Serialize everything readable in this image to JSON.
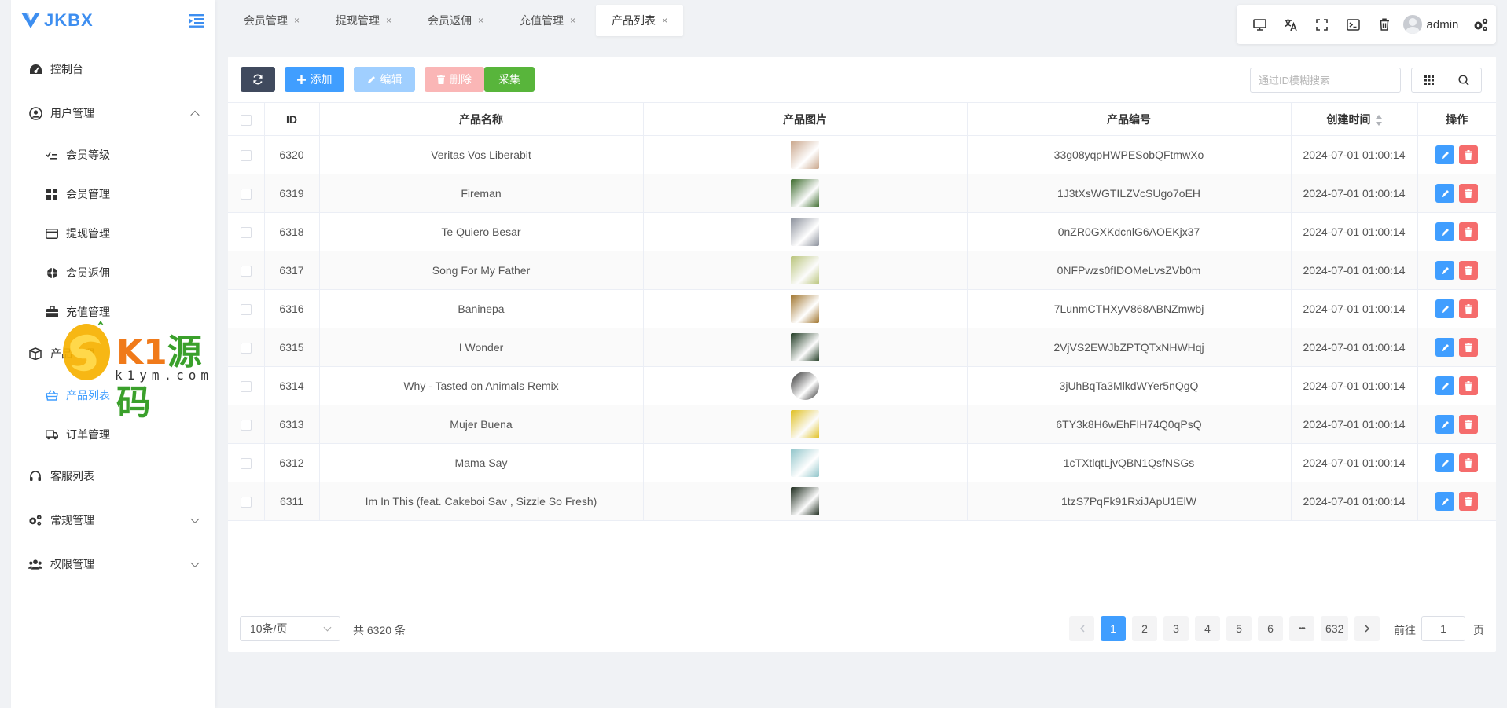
{
  "app": {
    "logo_text": "JKBX"
  },
  "sidebar": {
    "items": [
      {
        "label": "控制台",
        "icon": "dashboard-icon"
      },
      {
        "label": "用户管理",
        "icon": "user-circle-icon",
        "expanded": true
      },
      {
        "label": "会员等级",
        "icon": "level-icon"
      },
      {
        "label": "会员管理",
        "icon": "grid-icon"
      },
      {
        "label": "提现管理",
        "icon": "card-icon"
      },
      {
        "label": "会员返佣",
        "icon": "target-icon"
      },
      {
        "label": "充值管理",
        "icon": "briefcase-icon"
      },
      {
        "label": "产品管理",
        "icon": "box-icon"
      },
      {
        "label": "产品列表",
        "icon": "basket-icon",
        "active": true
      },
      {
        "label": "订单管理",
        "icon": "truck-icon"
      },
      {
        "label": "客服列表",
        "icon": "headset-icon"
      },
      {
        "label": "常规管理",
        "icon": "gears-icon"
      },
      {
        "label": "权限管理",
        "icon": "users-icon"
      }
    ]
  },
  "watermark": {
    "brand_a": "K1",
    "brand_b": "源码",
    "url": "k1ym.com"
  },
  "tabs": [
    {
      "label": "会员管理",
      "close": "×"
    },
    {
      "label": "提现管理",
      "close": "×"
    },
    {
      "label": "会员返佣",
      "close": "×"
    },
    {
      "label": "充值管理",
      "close": "×"
    },
    {
      "label": "产品列表",
      "close": "×",
      "active": true
    }
  ],
  "topbar": {
    "user": "admin"
  },
  "toolbar": {
    "add_label": "添加",
    "edit_label": "编辑",
    "delete_label": "删除",
    "collect_label": "采集",
    "search_placeholder": "通过ID模糊搜索"
  },
  "table": {
    "columns": [
      "ID",
      "产品名称",
      "产品图片",
      "产品编号",
      "创建时间",
      "操作"
    ],
    "rows": [
      {
        "id": "6320",
        "name": "Veritas Vos Liberabit",
        "code": "33g08yqpHWPESobQFtmwXo",
        "created": "2024-07-01 01:00:14",
        "thumb": "#c9a58a"
      },
      {
        "id": "6319",
        "name": "Fireman",
        "code": "1J3tXsWGTILZVcSUgo7oEH",
        "created": "2024-07-01 01:00:14",
        "thumb": "#3c6b2c"
      },
      {
        "id": "6318",
        "name": "Te Quiero Besar",
        "code": "0nZR0GXKdcnlG6AOEKjx37",
        "created": "2024-07-01 01:00:14",
        "thumb": "#8a8f9a"
      },
      {
        "id": "6317",
        "name": "Song For My Father",
        "code": "0NFPwzs0fIDOMeLvsZVb0m",
        "created": "2024-07-01 01:00:14",
        "thumb": "#b9c47a"
      },
      {
        "id": "6316",
        "name": "Baninepa",
        "code": "7LunmCTHXyV868ABNZmwbj",
        "created": "2024-07-01 01:00:14",
        "thumb": "#a0742c"
      },
      {
        "id": "6315",
        "name": "I Wonder",
        "code": "2VjVS2EWJbZPTQTxNHWHqj",
        "created": "2024-07-01 01:00:14",
        "thumb": "#1f3a22"
      },
      {
        "id": "6314",
        "name": "Why - Tasted on Animals Remix",
        "code": "3jUhBqTa3MlkdWYer5nQgQ",
        "created": "2024-07-01 01:00:14",
        "thumb": "#2b2b2b"
      },
      {
        "id": "6313",
        "name": "Mujer Buena",
        "code": "6TY3k8H6wEhFIH74Q0qPsQ",
        "created": "2024-07-01 01:00:14",
        "thumb": "#e0c020"
      },
      {
        "id": "6312",
        "name": "Mama Say",
        "code": "1cTXtlqtLjvQBN1QsfNSGs",
        "created": "2024-07-01 01:00:14",
        "thumb": "#8fc4c9"
      },
      {
        "id": "6311",
        "name": "Im In This (feat. Cakeboi Sav , Sizzle So Fresh)",
        "code": "1tzS7PqFk91RxiJApU1ElW",
        "created": "2024-07-01 01:00:14",
        "thumb": "#1c2a1c"
      }
    ]
  },
  "pagination": {
    "page_size": "10条/页",
    "total": "共 6320 条",
    "pages": [
      "1",
      "2",
      "3",
      "4",
      "5",
      "6"
    ],
    "ellipsis": "•••",
    "last": "632",
    "current": "1",
    "goto_label": "前往",
    "goto_value": "1",
    "unit": "页"
  },
  "colors": {
    "primary": "#409eff",
    "danger": "#f56c6c",
    "success": "#58b53b",
    "dark": "#404a5e"
  }
}
